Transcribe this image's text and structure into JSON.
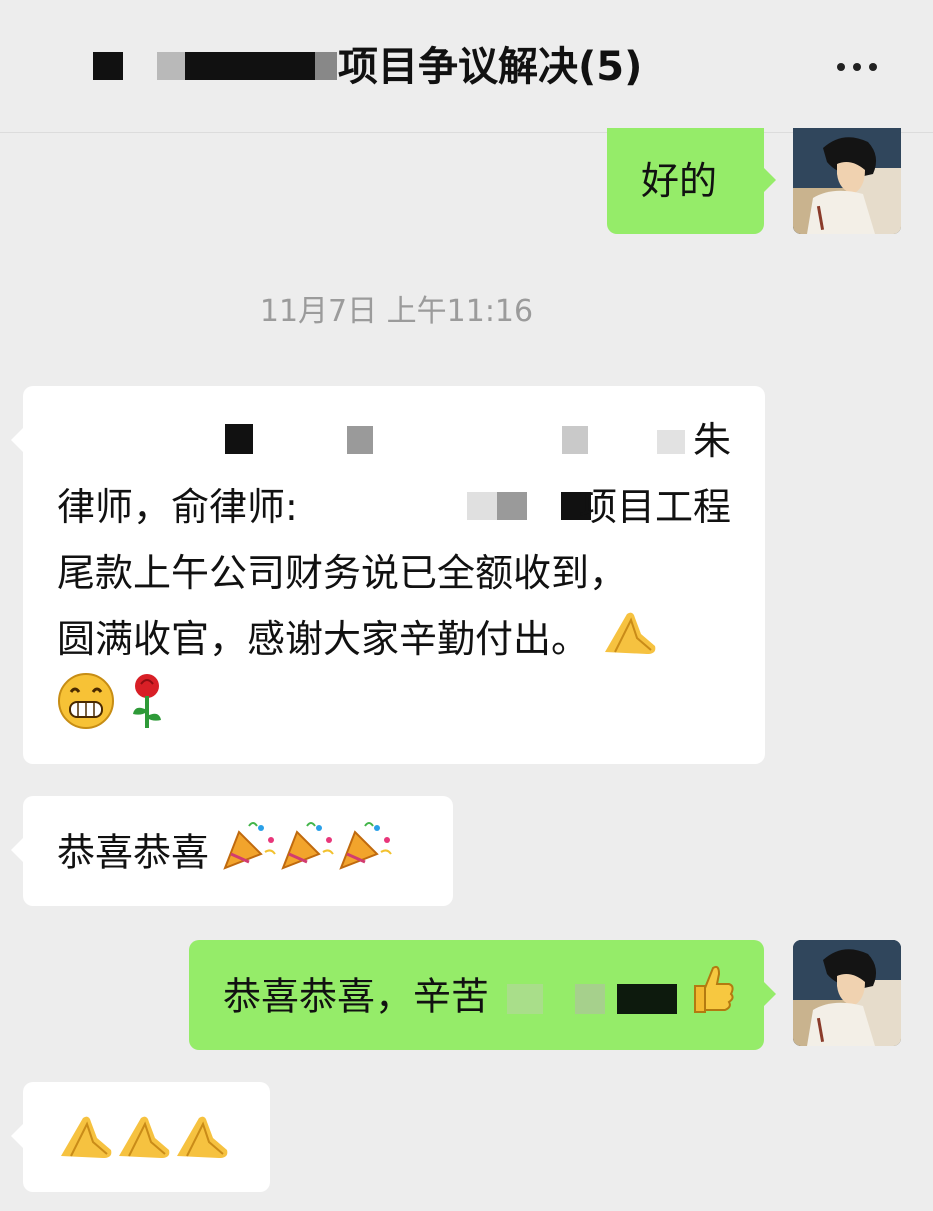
{
  "header": {
    "title": "项目争议解决(5)"
  },
  "messages": {
    "m1": {
      "text": "好的"
    },
    "timestamp": "11月7日 上午11:16",
    "m2": {
      "line1_end": "朱",
      "line2_start": "律师，俞律师:",
      "line2_end": "项目工程",
      "line3": "尾款上午公司财务说已全额收到，",
      "line4": "圆满收官，感谢大家辛勤付出。"
    },
    "m3": {
      "text": "恭喜恭喜"
    },
    "m4": {
      "text": "恭喜恭喜，辛苦"
    }
  },
  "icons": {
    "more": "more-icon",
    "folded_hands": "folded-hands-icon",
    "grin": "grinning-face-icon",
    "rose": "rose-icon",
    "party": "party-popper-icon",
    "thumbs": "thumbs-up-icon",
    "avatar": "avatar-image"
  }
}
